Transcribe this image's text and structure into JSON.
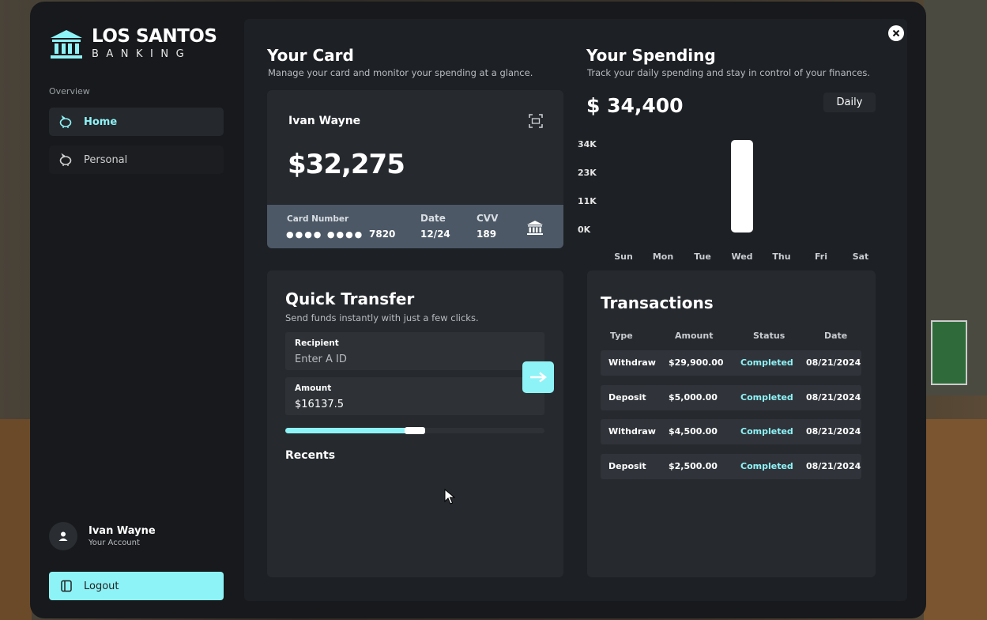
{
  "brand": {
    "title": "LOS SANTOS",
    "subtitle": "BANKING"
  },
  "sidebar": {
    "section_label": "Overview",
    "items": [
      {
        "label": "Home",
        "icon": "piggy-bank-icon",
        "active": true
      },
      {
        "label": "Personal",
        "icon": "piggy-bank-icon",
        "active": false
      }
    ],
    "user": {
      "name": "Ivan Wayne",
      "subtitle": "Your Account"
    },
    "logout_label": "Logout"
  },
  "card_section": {
    "title": "Your Card",
    "subtitle": "Manage your card and monitor your spending at a glance.",
    "holder": "Ivan Wayne",
    "balance": "$32,275",
    "card_number_label": "Card Number",
    "card_number_mask": "●●●● ●●●●",
    "card_number_last": "7820",
    "date_label": "Date",
    "date_value": "12/24",
    "cvv_label": "CVV",
    "cvv_value": "189"
  },
  "spending_section": {
    "title": "Your Spending",
    "subtitle": "Track your daily spending and stay in control of your finances.",
    "total": "$ 34,400",
    "period_button": "Daily"
  },
  "chart_data": {
    "type": "bar",
    "categories": [
      "Sun",
      "Mon",
      "Tue",
      "Wed",
      "Thu",
      "Fri",
      "Sat"
    ],
    "values": [
      0,
      0,
      0,
      34400,
      0,
      0,
      0
    ],
    "y_ticks": [
      "34K",
      "23K",
      "11K",
      "0K"
    ],
    "ylim": [
      0,
      34400
    ],
    "bar_color": "#ffffff",
    "grid": false
  },
  "transfer_section": {
    "title": "Quick Transfer",
    "subtitle": "Send funds instantly with just a few clicks.",
    "recipient_label": "Recipient",
    "recipient_placeholder": "Enter A ID",
    "amount_label": "Amount",
    "amount_value": "$16137.5",
    "slider_fraction": 0.54,
    "recents_label": "Recents"
  },
  "transactions": {
    "title": "Transactions",
    "headers": [
      "Type",
      "Amount",
      "Status",
      "Date"
    ],
    "rows": [
      {
        "type": "Withdraw",
        "amount": "$29,900.00",
        "status": "Completed",
        "date": "08/21/2024"
      },
      {
        "type": "Deposit",
        "amount": "$5,000.00",
        "status": "Completed",
        "date": "08/21/2024"
      },
      {
        "type": "Withdraw",
        "amount": "$4,500.00",
        "status": "Completed",
        "date": "08/21/2024"
      },
      {
        "type": "Deposit",
        "amount": "$2,500.00",
        "status": "Completed",
        "date": "08/21/2024"
      }
    ]
  },
  "colors": {
    "accent": "#8ef3f7",
    "background": "#17191c",
    "panel": "#262a2f"
  }
}
